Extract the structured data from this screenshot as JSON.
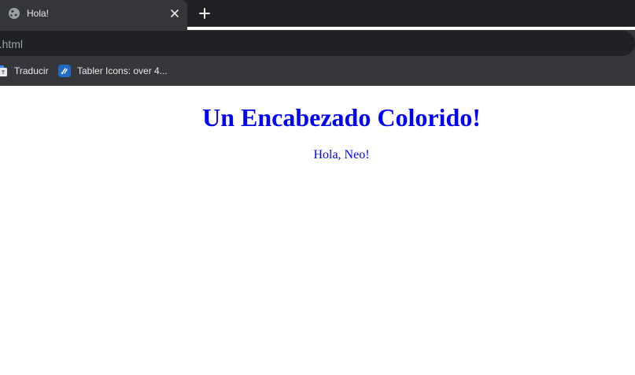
{
  "tab": {
    "title": "Hola!",
    "favicon": "globe-icon"
  },
  "address_bar": {
    "url": "ola.html"
  },
  "bookmarks": [
    {
      "label": "Traducir",
      "icon": "translate-icon"
    },
    {
      "label": "Tabler Icons: over 4...",
      "icon": "tabler-icon"
    }
  ],
  "page": {
    "heading": "Un Encabezado Colorido!",
    "paragraph": "Hola, Neo!",
    "text_color": "#0000ff"
  },
  "theme": {
    "tab_strip": "#202124",
    "toolbar": "#35363a",
    "text": "#e8eaed"
  }
}
